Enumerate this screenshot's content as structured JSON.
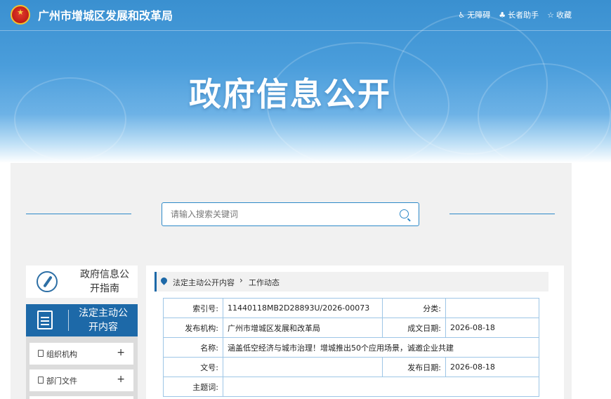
{
  "header": {
    "site_title": "广州市增城区发展和改革局",
    "tools": [
      {
        "icon": "wheelchair-icon",
        "label": "无障碍"
      },
      {
        "icon": "elder-helper-icon",
        "label": "长者助手"
      },
      {
        "icon": "star-icon",
        "label": "收藏"
      }
    ],
    "banner_title": "政府信息公开"
  },
  "search": {
    "placeholder": "请输入搜索关键词"
  },
  "sidebar": {
    "guide_label": "政府信息公开指南",
    "active_label": "法定主动公开内容",
    "items": [
      {
        "label": "组织机构",
        "toggle": "+"
      },
      {
        "label": "部门文件",
        "toggle": "+"
      }
    ]
  },
  "breadcrumb": {
    "level1": "法定主动公开内容",
    "separator": "›",
    "level2": "工作动态"
  },
  "meta": {
    "index_label": "索引号:",
    "index_value": "11440118MB2D28893U/2026-00073",
    "category_label": "分类:",
    "category_value": "",
    "publisher_label": "发布机构:",
    "publisher_value": "广州市增城区发展和改革局",
    "created_label": "成文日期:",
    "created_value": "2026-08-18",
    "name_label": "名称:",
    "name_value": "涵盖低空经济与城市治理！增城推出50个应用场景，诚邀企业共建",
    "docno_label": "文号:",
    "docno_value": "",
    "published_label": "发布日期:",
    "published_value": "2026-08-18",
    "subject_label": "主题词:",
    "subject_value": ""
  },
  "colors": {
    "primary": "#1d69a8",
    "accent": "#2d89c8",
    "panel_bg": "#f1f1f1"
  }
}
